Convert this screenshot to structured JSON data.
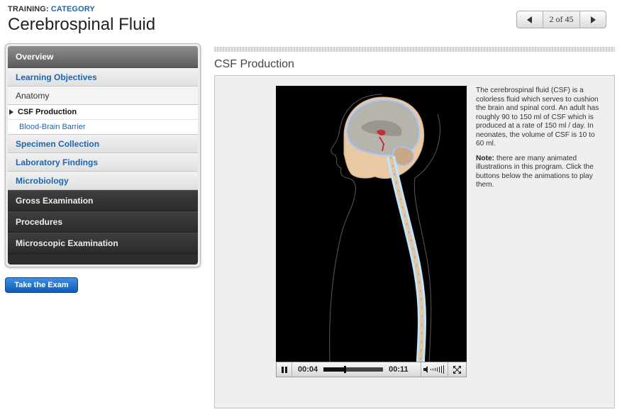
{
  "header": {
    "crumb_prefix": "TRAINING:",
    "crumb_category": "CATEGORY",
    "title": "Cerebrospinal Fluid",
    "pager": {
      "prev_icon": "triangle-left-icon",
      "count": "2 of 45",
      "next_icon": "triangle-right-icon"
    }
  },
  "sidebar": {
    "overview": "Overview",
    "learning_objectives": "Learning Objectives",
    "anatomy": "Anatomy",
    "csf_production": "CSF Production",
    "blood_brain_barrier": "Blood-Brain Barrier",
    "specimen_collection": "Specimen Collection",
    "laboratory_findings": "Laboratory Findings",
    "microbiology": "Microbiology",
    "gross_examination": "Gross Examination",
    "procedures": "Procedures",
    "microscopic_examination": "Microscopic Examination"
  },
  "exam_button": "Take the Exam",
  "content": {
    "section_title": "CSF Production",
    "description_1": "The cerebrospinal fluid (CSF) is a colorless fluid which serves to cushion the brain and spinal cord. An adult has roughly 90 to 150 ml of CSF which is produced at a rate of 150 ml / day. In neonates, the volume of CSF is 10 to 60 ml.",
    "note_label": "Note:",
    "note_text": " there are many animated illustrations in this program. Click the buttons below the animations to play them."
  },
  "player": {
    "current_time": "00:04",
    "duration": "00:11",
    "progress": 0.36,
    "state": "playing"
  },
  "colors": {
    "link_blue": "#1a66b3",
    "menu_dark": "#2d2d2d",
    "exam_button": "#1a6fd0"
  }
}
